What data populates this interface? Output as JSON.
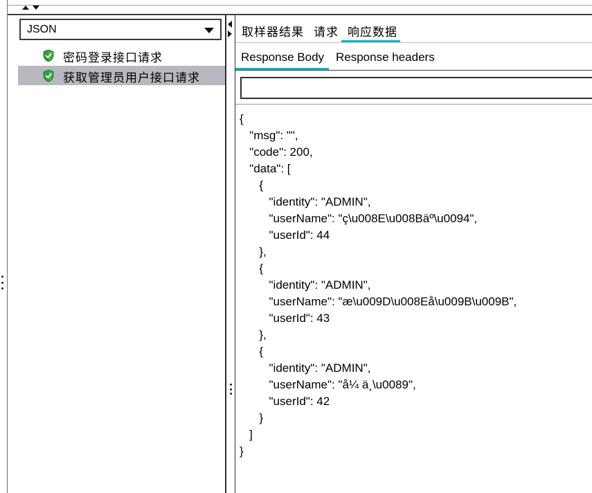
{
  "left_panel": {
    "format_select": {
      "value": "JSON"
    },
    "tree_items": [
      {
        "label": "密码登录接口请求",
        "status": "success",
        "selected": false
      },
      {
        "label": "获取管理员用户接口请求",
        "status": "success",
        "selected": true
      }
    ]
  },
  "right_panel": {
    "tabs": [
      {
        "label": "取样器结果",
        "active": false
      },
      {
        "label": "请求",
        "active": false
      },
      {
        "label": "响应数据",
        "active": true
      }
    ],
    "subtabs": [
      {
        "label": "Response Body",
        "active": true
      },
      {
        "label": "Response headers",
        "active": false
      }
    ],
    "search": {
      "value": "",
      "placeholder": ""
    },
    "response_body_lines": [
      "{",
      "   \"msg\": \"\",",
      "   \"code\": 200,",
      "   \"data\": [",
      "      {",
      "         \"identity\": \"ADMIN\",",
      "         \"userName\": \"ç\\u008E\\u008Bäº\\u0094\",",
      "         \"userId\": 44",
      "      },",
      "      {",
      "         \"identity\": \"ADMIN\",",
      "         \"userName\": \"æ\\u009D\\u008Eå\\u009B\\u009B\",",
      "         \"userId\": 43",
      "      },",
      "      {",
      "         \"identity\": \"ADMIN\",",
      "         \"userName\": \"å¼ ä¸\\u0089\",",
      "         \"userId\": 42",
      "      }",
      "   ]",
      "}"
    ]
  },
  "colors": {
    "accent": "#0fb5c5",
    "selected_row": "#b8b8c0",
    "success_shield": "#2e9d3a"
  },
  "icons": {
    "status": "shield-check-icon",
    "dropdown": "chevron-down-icon"
  }
}
